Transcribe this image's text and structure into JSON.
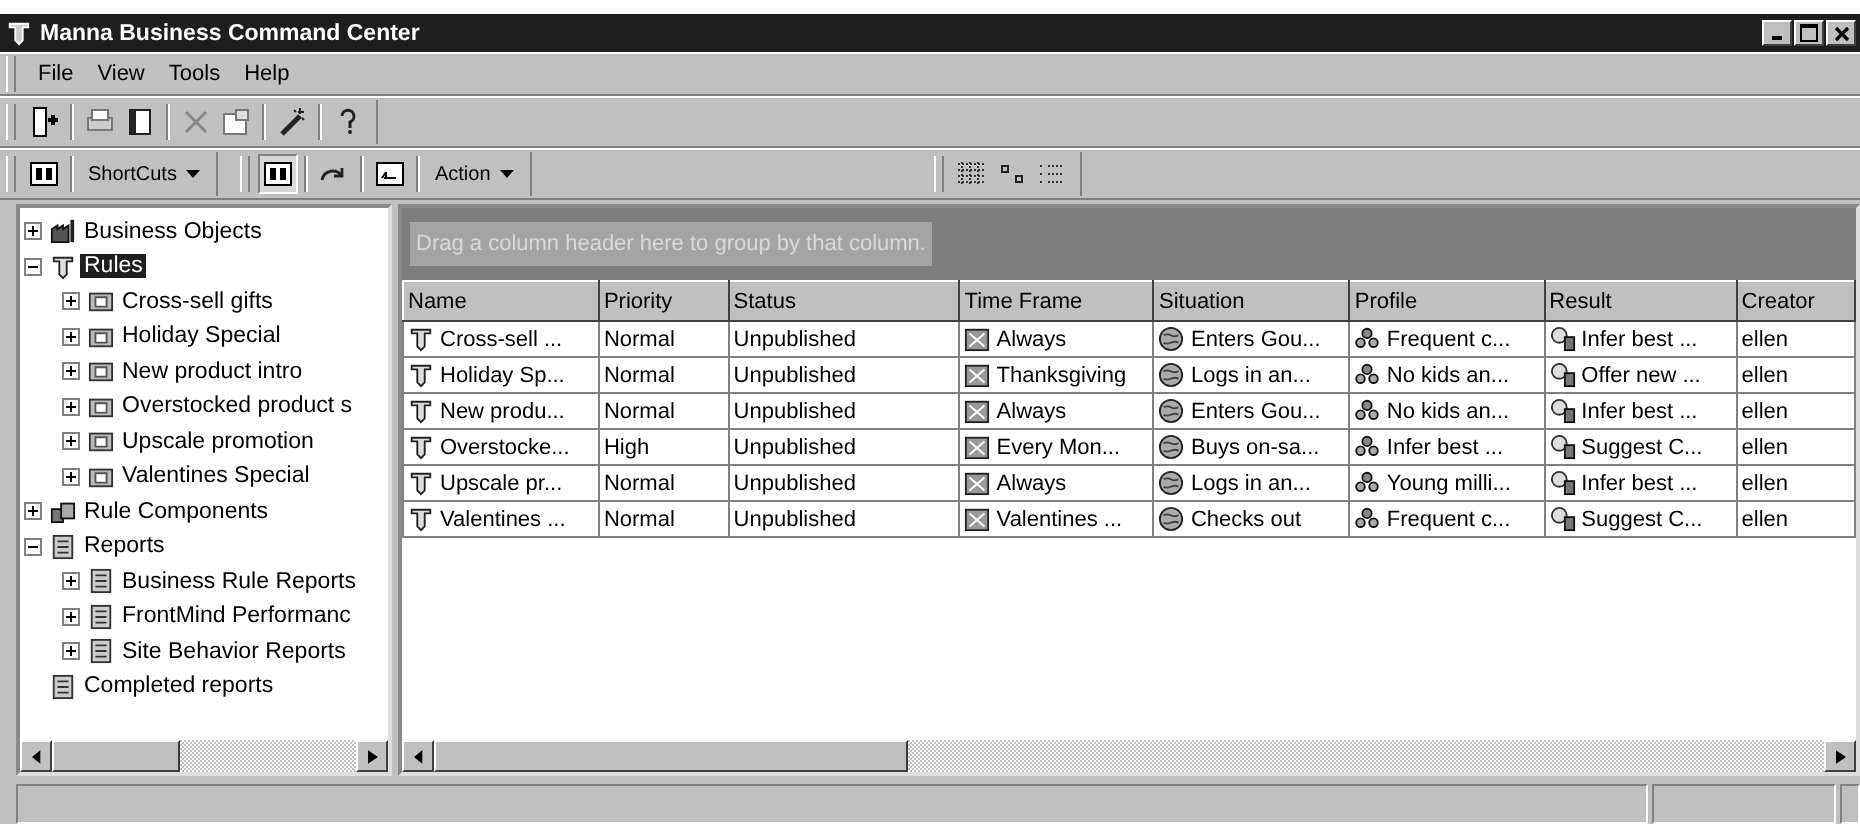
{
  "window": {
    "title": "Manna Business Command Center"
  },
  "menu": [
    "File",
    "View",
    "Tools",
    "Help"
  ],
  "toolbar2": {
    "shortcuts": "ShortCuts",
    "action": "Action"
  },
  "tree": [
    {
      "label": "Business Objects",
      "kind": "objects",
      "expanded": false,
      "selected": false
    },
    {
      "label": "Rules",
      "kind": "rule",
      "expanded": true,
      "selected": true,
      "children": [
        {
          "label": "Cross-sell gifts",
          "kind": "ruleset",
          "expanded": false,
          "selected": false
        },
        {
          "label": "Holiday Special",
          "kind": "ruleset",
          "expanded": false,
          "selected": false
        },
        {
          "label": "New product intro",
          "kind": "ruleset",
          "expanded": false,
          "selected": false
        },
        {
          "label": "Overstocked product s",
          "kind": "ruleset",
          "expanded": false,
          "selected": false
        },
        {
          "label": "Upscale promotion",
          "kind": "ruleset",
          "expanded": false,
          "selected": false
        },
        {
          "label": "Valentines Special",
          "kind": "ruleset",
          "expanded": false,
          "selected": false
        }
      ]
    },
    {
      "label": "Rule Components",
      "kind": "components",
      "expanded": false,
      "selected": false
    },
    {
      "label": "Reports",
      "kind": "report",
      "expanded": true,
      "selected": false,
      "children": [
        {
          "label": "Business Rule Reports",
          "kind": "report",
          "expanded": false,
          "selected": false
        },
        {
          "label": "FrontMind Performanc",
          "kind": "report",
          "expanded": false,
          "selected": false
        },
        {
          "label": "Site Behavior Reports",
          "kind": "report",
          "expanded": false,
          "selected": false
        }
      ]
    },
    {
      "label": "Completed reports",
      "kind": "report",
      "selected": false
    }
  ],
  "group_hint": "Drag a column header here to group by that column.",
  "table": {
    "columns": [
      {
        "label": "Name"
      },
      {
        "label": "Priority"
      },
      {
        "label": "Status"
      },
      {
        "label": "Time Frame"
      },
      {
        "label": "Situation"
      },
      {
        "label": "Profile"
      },
      {
        "label": "Result"
      },
      {
        "label": "Creator"
      }
    ],
    "rows": [
      [
        "Cross-sell ...",
        "Normal",
        "Unpublished",
        "Always",
        "Enters Gou...",
        "Frequent c...",
        "Infer best ...",
        "ellen"
      ],
      [
        "Holiday Sp...",
        "Normal",
        "Unpublished",
        "Thanksgiving",
        "Logs in an...",
        "No kids an...",
        "Offer new ...",
        "ellen"
      ],
      [
        "New produ...",
        "Normal",
        "Unpublished",
        "Always",
        "Enters Gou...",
        "No kids an...",
        "Infer best ...",
        "ellen"
      ],
      [
        "Overstocke...",
        "High",
        "Unpublished",
        "Every Mon...",
        "Buys on-sa...",
        "Infer best ...",
        "Suggest C...",
        "ellen"
      ],
      [
        "Upscale pr...",
        "Normal",
        "Unpublished",
        "Always",
        "Logs in an...",
        "Young milli...",
        "Infer best ...",
        "ellen"
      ],
      [
        "Valentines ...",
        "Normal",
        "Unpublished",
        "Valentines ...",
        "Checks out",
        "Frequent c...",
        "Suggest C...",
        "ellen"
      ]
    ]
  }
}
